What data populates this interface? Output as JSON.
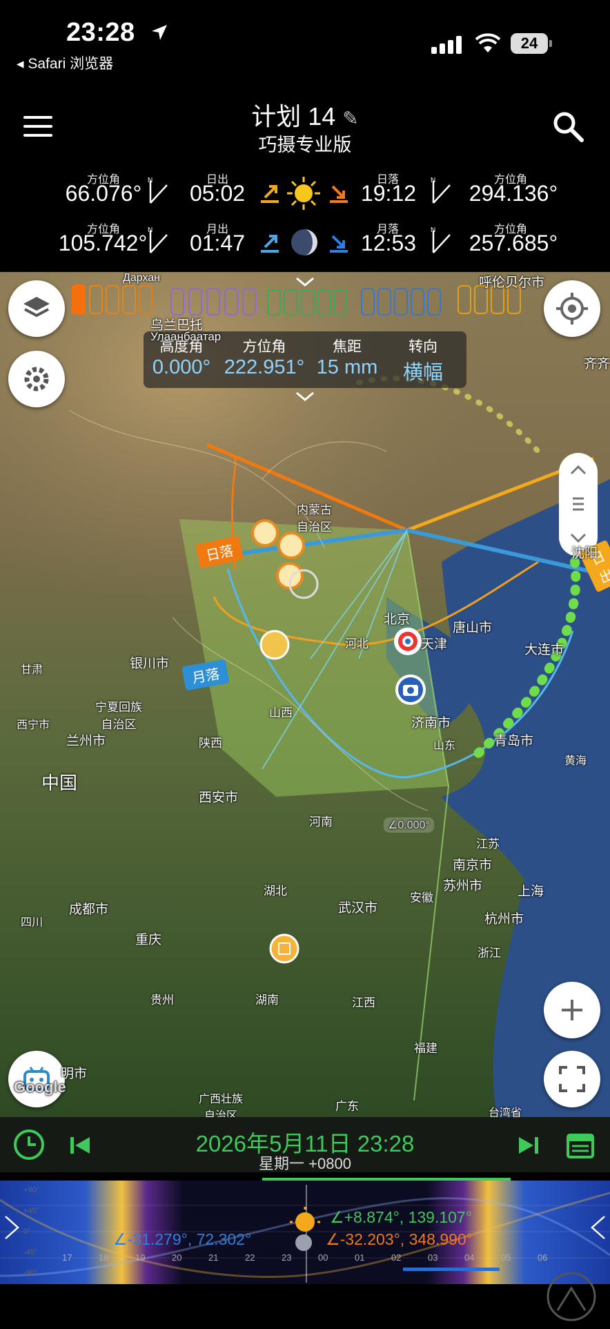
{
  "status": {
    "time": "23:28",
    "back_label": "◂ Safari 浏览器",
    "battery": "24"
  },
  "header": {
    "title": "计划 14",
    "subtitle": "巧摄专业版"
  },
  "sun": {
    "rise_az_caption": "方位角",
    "rise_az": "66.076°",
    "rise_caption": "日出",
    "rise_time": "05:02",
    "set_caption": "日落",
    "set_time": "19:12",
    "set_az_caption": "方位角",
    "set_az": "294.136°"
  },
  "moon": {
    "rise_az_caption": "方位角",
    "rise_az": "105.742°",
    "rise_caption": "月出",
    "rise_time": "01:47",
    "set_caption": "月落",
    "set_time": "12:53",
    "set_az_caption": "方位角",
    "set_az": "257.685°"
  },
  "info_panel": {
    "captions": [
      "高度角",
      "方位角",
      "焦距",
      "转向"
    ],
    "values": [
      "0.000°",
      "222.951°",
      "15 mm",
      "横幅"
    ]
  },
  "map": {
    "labels": [
      {
        "t": "Дархан"
      },
      {
        "t": "呼伦贝尔市"
      },
      {
        "t": "乌兰巴托"
      },
      {
        "t": "Улаанбаатар"
      },
      {
        "t": "内蒙古\n自治区"
      },
      {
        "t": "北京"
      },
      {
        "t": "天津"
      },
      {
        "t": "河北"
      },
      {
        "t": "唐山市"
      },
      {
        "t": "大连市"
      },
      {
        "t": "沈阳"
      },
      {
        "t": "银川市"
      },
      {
        "t": "甘肃"
      },
      {
        "t": "宁夏回族\n自治区"
      },
      {
        "t": "山西"
      },
      {
        "t": "济南市"
      },
      {
        "t": "山东"
      },
      {
        "t": "青岛市"
      },
      {
        "t": "黄海"
      },
      {
        "t": "西宁市"
      },
      {
        "t": "兰州市"
      },
      {
        "t": "陕西"
      },
      {
        "t": "中国"
      },
      {
        "t": "西安市"
      },
      {
        "t": "河南"
      },
      {
        "t": "江苏"
      },
      {
        "t": "南京市"
      },
      {
        "t": "苏州市"
      },
      {
        "t": "上海"
      },
      {
        "t": "安徽"
      },
      {
        "t": "湖北"
      },
      {
        "t": "武汉市"
      },
      {
        "t": "杭州市"
      },
      {
        "t": "浙江"
      },
      {
        "t": "成都市"
      },
      {
        "t": "四川"
      },
      {
        "t": "重庆"
      },
      {
        "t": "贵州"
      },
      {
        "t": "湖南"
      },
      {
        "t": "江西"
      },
      {
        "t": "福建"
      },
      {
        "t": "广西壮族\n自治区"
      },
      {
        "t": "广东"
      },
      {
        "t": "台湾省"
      },
      {
        "t": "明市"
      },
      {
        "t": "齐齐"
      },
      {
        "t": "Google"
      }
    ],
    "sunset_tag": "日落",
    "moonset_tag": "月落",
    "sunrise_tag": "日出",
    "ring_value": "∠0.000°"
  },
  "datebar": {
    "date": "2026年5月11日 23:28",
    "weekday": "星期一 +0800"
  },
  "timeline": {
    "hours": [
      "17",
      "18",
      "19",
      "20",
      "21",
      "22",
      "23",
      "00",
      "01",
      "02",
      "03",
      "04",
      "05",
      "06"
    ],
    "sun_readout": "∠+8.874°, 139.107°",
    "moon_readout": "∠-31.279°, 72.302°",
    "moon2_readout": "∠-32.203°, 348.990°",
    "scale": [
      "+90°",
      "+45°",
      "0°",
      "-45°",
      "-90°"
    ]
  },
  "colors": {
    "accent_green": "#3fc95a",
    "sun_orange": "#f08a1c",
    "moon_blue": "#3a9ad9"
  }
}
